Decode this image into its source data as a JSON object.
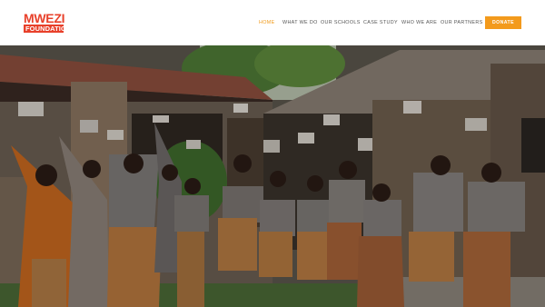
{
  "brand": {
    "name_line1": "MWEZI",
    "name_line2": "FOUNDATION"
  },
  "nav": {
    "items": [
      {
        "label": "HOME",
        "active": true
      },
      {
        "label": "WHAT WE DO",
        "active": false
      },
      {
        "label": "OUR SCHOOLS",
        "active": false
      },
      {
        "label": "CASE STUDY",
        "active": false
      },
      {
        "label": "WHO WE ARE",
        "active": false
      },
      {
        "label": "OUR PARTNERS",
        "active": false
      }
    ],
    "donate_label": "DONATE"
  },
  "colors": {
    "accent": "#f39a1c",
    "active_nav": "#f09a1a",
    "logo_red": "#e8402a",
    "nav_text": "#555555"
  },
  "hero": {
    "image": "students-raising-solar-lights-photo"
  }
}
